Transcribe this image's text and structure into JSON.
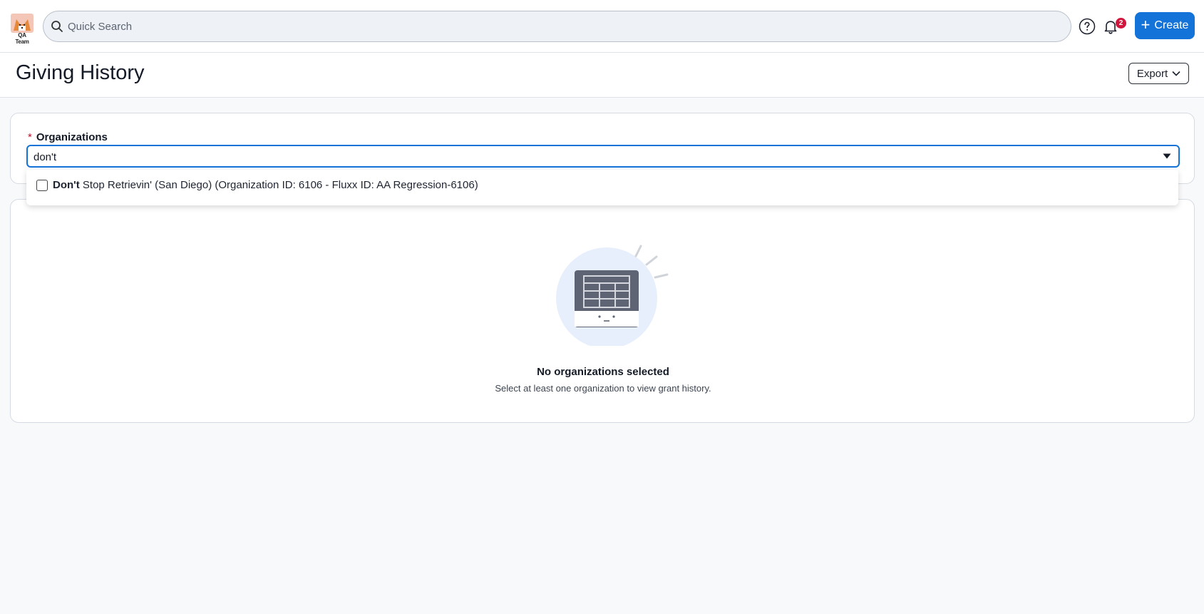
{
  "header": {
    "logo_text": "QA Team",
    "search_placeholder": "Quick Search",
    "notification_count": "2",
    "create_label": "Create"
  },
  "page": {
    "title": "Giving History",
    "export_label": "Export"
  },
  "filters": {
    "organizations_label": "Organizations",
    "required_marker": "*",
    "query": "don't",
    "options": [
      {
        "match": "Don't",
        "rest": " Stop Retrievin' (San Diego) (Organization ID: 6106 - Fluxx ID: AA Regression-6106)",
        "checked": false
      }
    ]
  },
  "empty_state": {
    "title": "No organizations selected",
    "message": "Select at least one organization to view grant history."
  },
  "colors": {
    "accent": "#1473d8",
    "badge": "#d2153d",
    "required": "#c8102e"
  }
}
